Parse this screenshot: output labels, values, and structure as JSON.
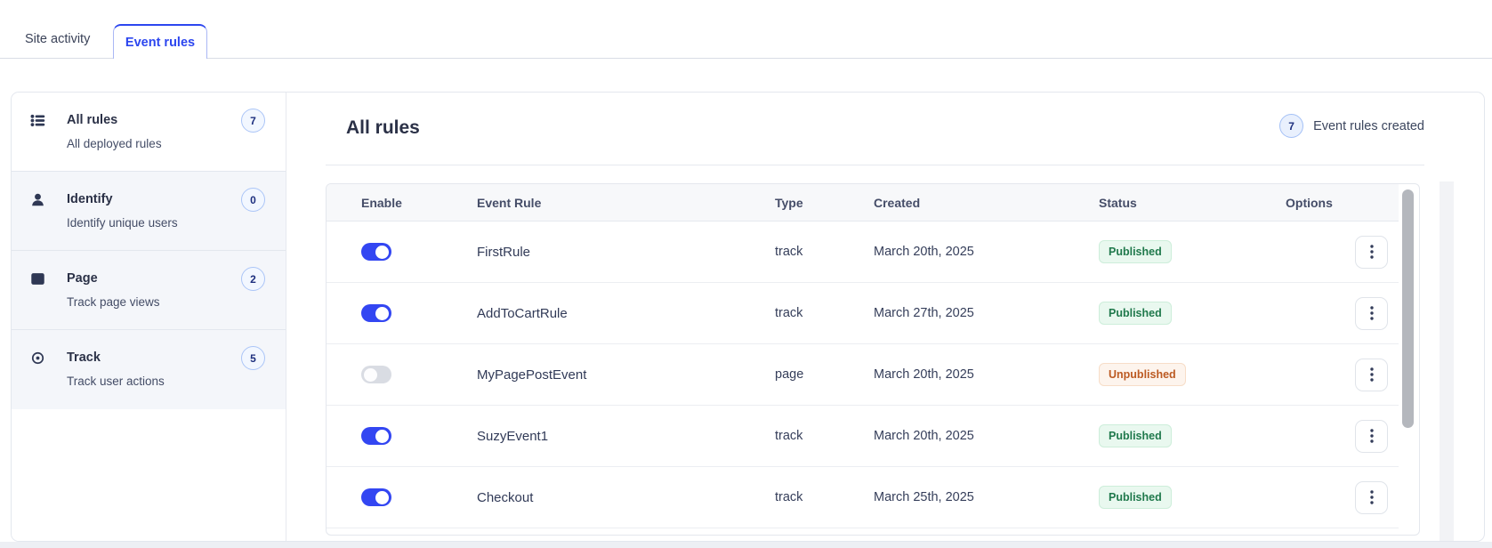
{
  "tabs": {
    "site_activity": "Site activity",
    "event_rules": "Event rules"
  },
  "sidebar": {
    "items": [
      {
        "icon": "list-icon",
        "title": "All rules",
        "count": "7",
        "description": "All deployed rules",
        "active": true
      },
      {
        "icon": "user-icon",
        "title": "Identify",
        "count": "0",
        "description": "Identify unique users",
        "active": false
      },
      {
        "icon": "window-icon",
        "title": "Page",
        "count": "2",
        "description": "Track page views",
        "active": false
      },
      {
        "icon": "target-icon",
        "title": "Track",
        "count": "5",
        "description": "Track user actions",
        "active": false
      }
    ]
  },
  "main": {
    "title": "All rules",
    "summary": {
      "count": "7",
      "label": "Event rules created"
    },
    "table": {
      "columns": [
        "Enable",
        "Event Rule",
        "Type",
        "Created",
        "Status",
        "Options"
      ],
      "rows": [
        {
          "enabled": true,
          "name": "FirstRule",
          "type": "track",
          "created": "March 20th, 2025",
          "status": "Published",
          "status_variant": "published"
        },
        {
          "enabled": true,
          "name": "AddToCartRule",
          "type": "track",
          "created": "March 27th, 2025",
          "status": "Published",
          "status_variant": "published"
        },
        {
          "enabled": false,
          "name": "MyPagePostEvent",
          "type": "page",
          "created": "March 20th, 2025",
          "status": "Unpublished",
          "status_variant": "unpublished"
        },
        {
          "enabled": true,
          "name": "SuzyEvent1",
          "type": "track",
          "created": "March 20th, 2025",
          "status": "Published",
          "status_variant": "published"
        },
        {
          "enabled": true,
          "name": "Checkout",
          "type": "track",
          "created": "March 25th, 2025",
          "status": "Published",
          "status_variant": "published"
        }
      ]
    }
  },
  "colors": {
    "accent_blue": "#2c46ef",
    "toggle_on": "#3346f2",
    "published_text": "#20794c",
    "unpublished_text": "#bc5a22",
    "sidebar_tint": "#f4f6fa",
    "table_header_bg": "#f7f8fa"
  }
}
